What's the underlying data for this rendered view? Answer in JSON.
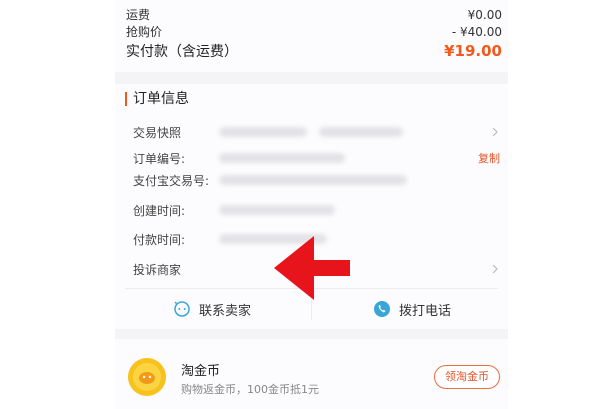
{
  "summary": {
    "shipping_label": "运费",
    "shipping_value": "¥0.00",
    "discount_label": "抢购价",
    "discount_value": "- ¥40.00",
    "total_label": "实付款（含运费）",
    "total_value": "¥19.00"
  },
  "order_info": {
    "title": "订单信息",
    "rows": [
      {
        "label": "交易快照",
        "action": ""
      },
      {
        "label": "订单编号:",
        "action": "复制"
      },
      {
        "label": "支付宝交易号:",
        "action": ""
      },
      {
        "label": "创建时间:",
        "action": ""
      },
      {
        "label": "付款时间:",
        "action": ""
      },
      {
        "label": "投诉商家",
        "action": ""
      }
    ],
    "contact_seller": "联系卖家",
    "call_phone": "拨打电话"
  },
  "coins": {
    "title": "淘金币",
    "subtitle": "购物返金币，100金币抵1元",
    "button": "领淘金币"
  },
  "colors": {
    "accent": "#f25a1c",
    "arrow": "#e8141c"
  },
  "icons": [
    "chevron-right-icon",
    "chat-icon",
    "phone-icon",
    "coin-icon",
    "arrow-left-icon"
  ]
}
